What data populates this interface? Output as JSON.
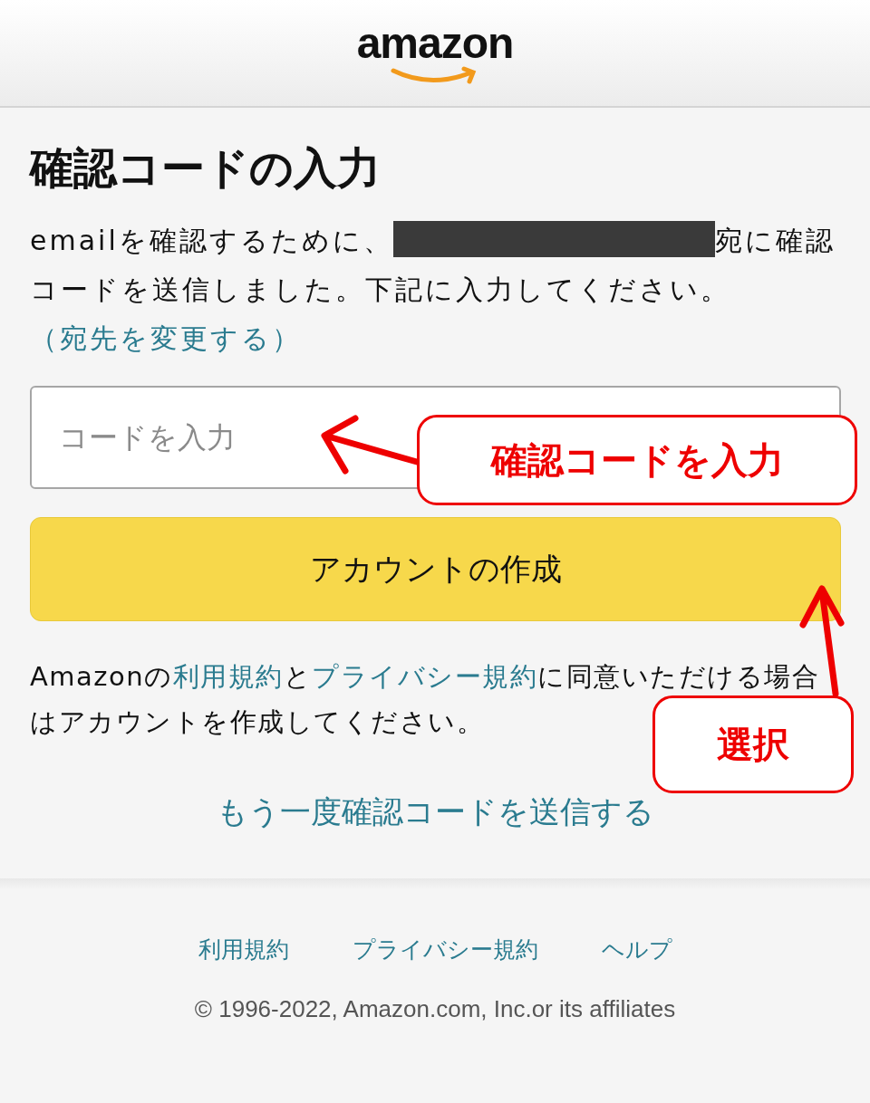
{
  "header": {
    "logo": "amazon"
  },
  "title": "確認コードの入力",
  "message": {
    "before": "emailを確認するために、",
    "after": "宛に確認コードを送信しました。下記に入力してください。",
    "change_link": "（宛先を変更する）"
  },
  "code_field": {
    "placeholder": "コードを入力"
  },
  "create_button": "アカウントの作成",
  "terms": [
    {
      "kind": "text",
      "text": "Amazonの"
    },
    {
      "kind": "link",
      "text": "利用規約"
    },
    {
      "kind": "text",
      "text": "と"
    },
    {
      "kind": "link",
      "text": "プライバシー規約"
    },
    {
      "kind": "text",
      "text": "に同意いただける場合はアカウントを作成してください。"
    }
  ],
  "resend_link": "もう一度確認コードを送信する",
  "footer_links": [
    "利用規約",
    "プライバシー規約",
    "ヘルプ"
  ],
  "copyright": "© 1996-2022, Amazon.com, Inc.or its affiliates",
  "annotations": [
    {
      "kind": "callout",
      "text": "確認コードを入力"
    },
    {
      "kind": "callout",
      "text": "選択"
    }
  ]
}
